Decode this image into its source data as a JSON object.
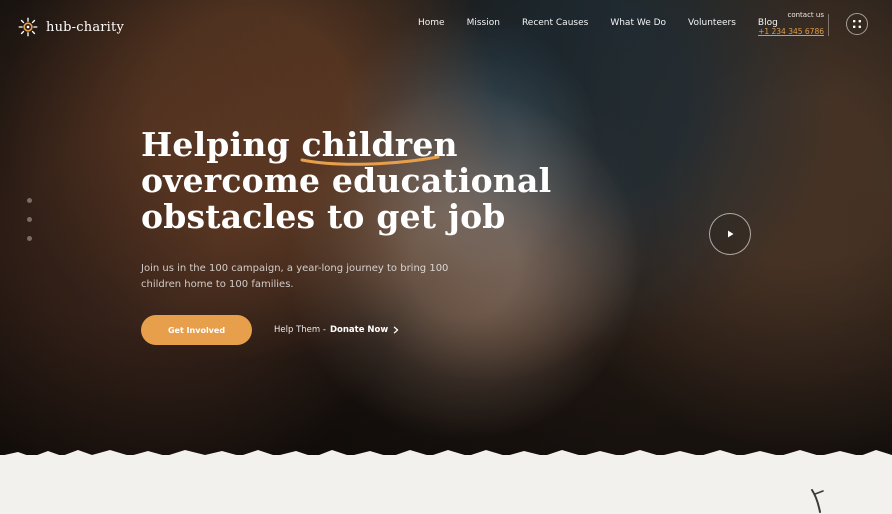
{
  "brand": {
    "name": "hub-charity",
    "logo_icon": "sun-logo-icon"
  },
  "nav": {
    "items": [
      {
        "label": "Home"
      },
      {
        "label": "Mission"
      },
      {
        "label": "Recent Causes"
      },
      {
        "label": "What We Do"
      },
      {
        "label": "Volunteers"
      },
      {
        "label": "Blog"
      }
    ]
  },
  "contact": {
    "label": "contact us",
    "phone": "+1 234 345 6786"
  },
  "hero": {
    "headline_line1_a": "Helping",
    "headline_line1_b": "children",
    "headline_line2": "overcome educational",
    "headline_line3": "obstacles to get job",
    "subtext": "Join us in the 100 campaign, a year-long journey to bring 100 children home to 100 families.",
    "primary_cta": "Get Involved",
    "help_prefix": "Help Them -",
    "help_action": "Donate Now"
  },
  "icons": {
    "menu": "grid-menu-icon",
    "play": "play-icon",
    "chevron": "chevron-right-icon"
  },
  "colors": {
    "accent": "#e79f4b",
    "page_background": "#f3f1ee"
  }
}
